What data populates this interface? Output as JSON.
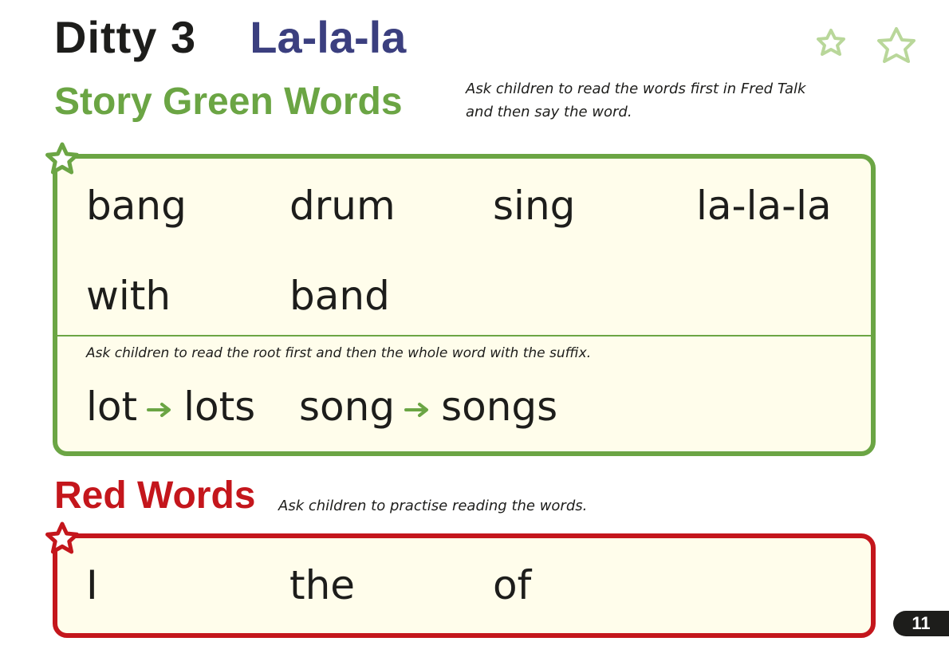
{
  "header": {
    "title": "Ditty 3",
    "subtitle": "La-la-la"
  },
  "green_section": {
    "heading": "Story Green Words",
    "instruction": "Ask children to read the words first in Fred Talk and then say the word.",
    "words": [
      "bang",
      "drum",
      "sing",
      "la-la-la",
      "with",
      "band"
    ],
    "suffix_instruction": "Ask children to read the root first and then the whole word with the suffix.",
    "suffix_pairs": [
      {
        "root": "lot",
        "word": "lots"
      },
      {
        "root": "song",
        "word": "songs"
      }
    ]
  },
  "red_section": {
    "heading": "Red Words",
    "instruction": "Ask children to practise reading the words.",
    "words": [
      "I",
      "the",
      "of"
    ]
  },
  "page_number": "11",
  "colors": {
    "green": "#6ba544",
    "red": "#c4161c",
    "title_purple": "#3b3f7f",
    "panel_fill": "#fffdeb"
  }
}
